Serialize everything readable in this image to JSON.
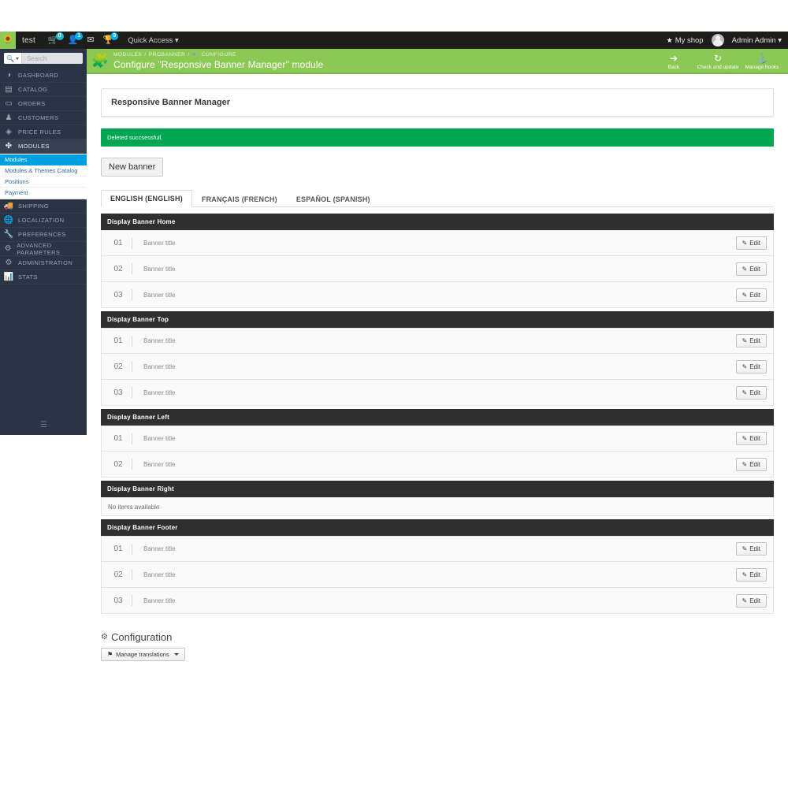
{
  "topbar": {
    "logo_icon": "prestashop-logo-icon",
    "shop_name": "test",
    "icons": [
      {
        "name": "cart-icon",
        "glyph": "🛒",
        "badge": "0"
      },
      {
        "name": "customers-icon",
        "glyph": "👤",
        "badge": "1"
      },
      {
        "name": "messages-icon",
        "glyph": "✉",
        "badge": ""
      },
      {
        "name": "trophy-icon",
        "glyph": "🏆",
        "badge": "9"
      }
    ],
    "quick_access": "Quick Access",
    "my_shop": "My shop",
    "admin_name": "Admin Admin"
  },
  "sidebar": {
    "search_placeholder": "Search",
    "search_icon": "magnifier-icon",
    "items": [
      {
        "label": "DASHBOARD",
        "icon": "dashboard-icon",
        "glyph": "◔",
        "active": false
      },
      {
        "label": "CATALOG",
        "icon": "catalog-icon",
        "glyph": "▤",
        "active": false
      },
      {
        "label": "ORDERS",
        "icon": "orders-icon",
        "glyph": "▭",
        "active": false
      },
      {
        "label": "CUSTOMERS",
        "icon": "customers-icon",
        "glyph": "♟",
        "active": false
      },
      {
        "label": "PRICE RULES",
        "icon": "price-rules-icon",
        "glyph": "◈",
        "active": false
      },
      {
        "label": "MODULES",
        "icon": "modules-icon",
        "glyph": "✤",
        "active": true
      }
    ],
    "submenu": [
      {
        "label": "Modules",
        "selected": true
      },
      {
        "label": "Modules & Themes Catalog",
        "selected": false
      },
      {
        "label": "Positions",
        "selected": false
      },
      {
        "label": "Payment",
        "selected": false
      }
    ],
    "items_after": [
      {
        "label": "SHIPPING",
        "icon": "shipping-icon",
        "glyph": "🚚"
      },
      {
        "label": "LOCALIZATION",
        "icon": "localization-icon",
        "glyph": "🌐"
      },
      {
        "label": "PREFERENCES",
        "icon": "preferences-icon",
        "glyph": "🔧"
      },
      {
        "label": "ADVANCED PARAMETERS",
        "icon": "advanced-parameters-icon",
        "glyph": "⚙"
      },
      {
        "label": "ADMINISTRATION",
        "icon": "administration-icon",
        "glyph": "⚙"
      },
      {
        "label": "STATS",
        "icon": "stats-icon",
        "glyph": "📊"
      }
    ],
    "collapse_icon": "collapse-menu-icon"
  },
  "page_header": {
    "puzzle_icon": "puzzle-piece-icon",
    "breadcrumb": [
      "MODULES",
      "PROBANNER",
      "CONFIGURE"
    ],
    "breadcrumb_wrench_icon": "wrench-icon",
    "title": "Configure \"Responsive Banner Manager\" module",
    "tools": [
      {
        "label": "Back",
        "icon": "back-arrow-icon",
        "glyph": "⬅"
      },
      {
        "label": "Check and update",
        "icon": "refresh-icon",
        "glyph": "↻"
      },
      {
        "label": "Manage hooks",
        "icon": "anchor-icon",
        "glyph": "⚓"
      }
    ]
  },
  "main": {
    "panel_title": "Responsive Banner Manager",
    "alert": "Deleted succsessfull.",
    "new_banner_label": "New banner",
    "tabs": [
      {
        "label": "ENGLISH (ENGLISH)",
        "active": true
      },
      {
        "label": "FRANÇAIS (FRENCH)",
        "active": false
      },
      {
        "label": "ESPAÑOL (SPANISH)",
        "active": false
      }
    ],
    "edit_label": "Edit",
    "edit_icon": "pencil-square-icon",
    "empty_text": "No items available",
    "sections": [
      {
        "title": "Display Banner Home",
        "rows": [
          {
            "num": "01",
            "title": "Banner title"
          },
          {
            "num": "02",
            "title": "Banner title"
          },
          {
            "num": "03",
            "title": "Banner title"
          }
        ]
      },
      {
        "title": "Display Banner Top",
        "rows": [
          {
            "num": "01",
            "title": "Banner title"
          },
          {
            "num": "02",
            "title": "Banner title"
          },
          {
            "num": "03",
            "title": "Banner title"
          }
        ]
      },
      {
        "title": "Display Banner Left",
        "rows": [
          {
            "num": "01",
            "title": "Banner title"
          },
          {
            "num": "02",
            "title": "Banner title"
          }
        ]
      },
      {
        "title": "Display Banner Right",
        "rows": []
      },
      {
        "title": "Display Banner Footer",
        "rows": [
          {
            "num": "01",
            "title": "Banner title"
          },
          {
            "num": "02",
            "title": "Banner title"
          },
          {
            "num": "03",
            "title": "Banner title"
          }
        ]
      }
    ],
    "configuration_title": "Configuration",
    "configuration_icon": "gears-icon",
    "manage_translations_label": "Manage translations",
    "flag_icon": "flag-icon"
  },
  "colors": {
    "green_header": "#8BC954",
    "alert_green": "#00a651",
    "sidebar_dark": "#2b3445",
    "topbar_black": "#1d1d1b",
    "submenu_selected": "#00a0e0",
    "section_head": "#2f2f2f"
  }
}
